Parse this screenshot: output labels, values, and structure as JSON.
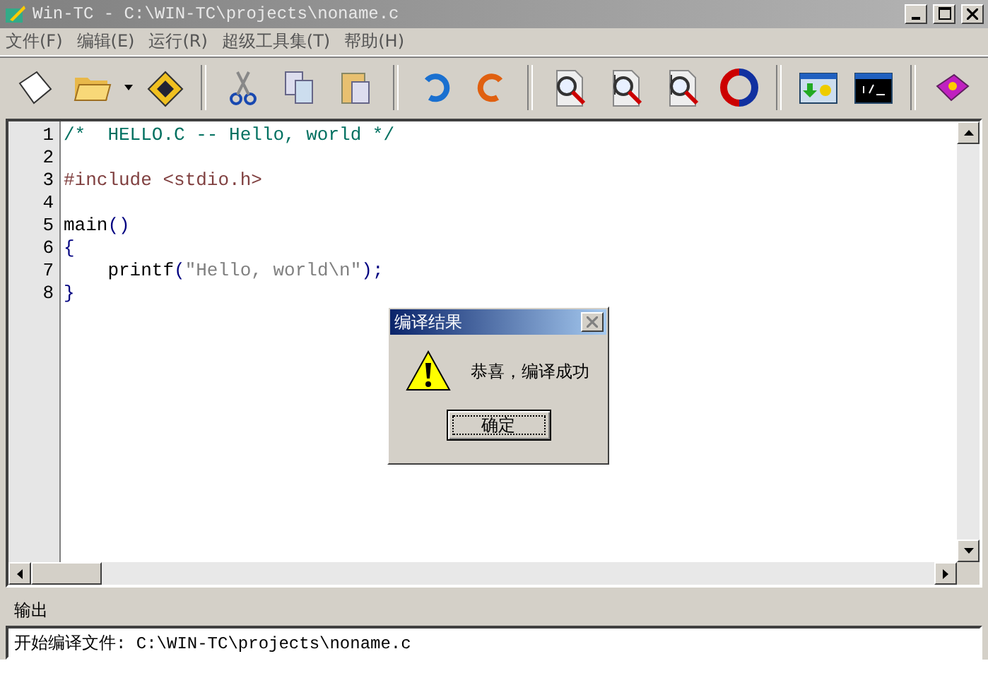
{
  "window": {
    "title": "Win-TC - C:\\WIN-TC\\projects\\noname.c"
  },
  "menu": [
    "文件(F)",
    "编辑(E)",
    "运行(R)",
    "超级工具集(T)",
    "帮助(H)"
  ],
  "editor": {
    "lines": [
      {
        "number": "1",
        "segments": [
          {
            "kind": "comment",
            "text": "/*  HELLO.C -- Hello, world */"
          }
        ]
      },
      {
        "number": "2"
      },
      {
        "number": "3",
        "segments": [
          {
            "kind": "preprocessor",
            "text": "#include <stdio.h>"
          }
        ]
      },
      {
        "number": "4"
      },
      {
        "number": "5",
        "segments": [
          {
            "kind": "plain",
            "text": "main"
          },
          {
            "kind": "punct",
            "text": "()"
          }
        ]
      },
      {
        "number": "6",
        "segments": [
          {
            "kind": "punct",
            "text": "{"
          }
        ]
      },
      {
        "number": "7",
        "segments": [
          {
            "kind": "plain",
            "text": "    printf"
          },
          {
            "kind": "punct",
            "text": "("
          },
          {
            "kind": "string",
            "text": "\"Hello, world\\n\""
          },
          {
            "kind": "punct",
            "text": ");"
          }
        ]
      },
      {
        "number": "8",
        "segments": [
          {
            "kind": "punct",
            "text": "}"
          }
        ]
      }
    ]
  },
  "dialog": {
    "title": "编译结果",
    "message": "恭喜，编译成功",
    "button": "确定"
  },
  "output": {
    "label": "输出",
    "text": "开始编译文件: C:\\WIN-TC\\projects\\noname.c"
  }
}
